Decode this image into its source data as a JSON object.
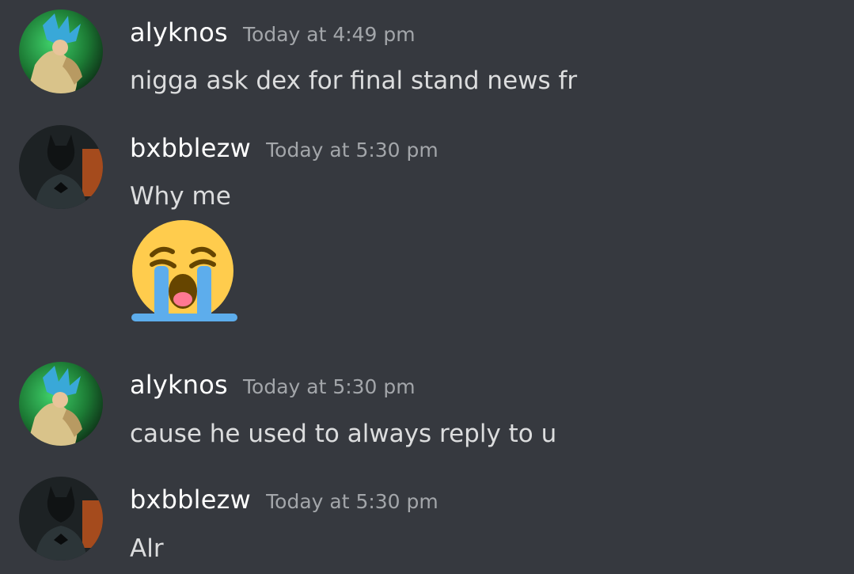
{
  "messages": [
    {
      "author": "alyknos",
      "timestamp": "Today at 4:49 pm",
      "text": "nigga ask dex for final stand news fr",
      "avatar_icon": "goku-avatar-icon"
    },
    {
      "author": "bxbblezw",
      "timestamp": "Today at 5:30 pm",
      "text": "Why me",
      "emoji": "loudly-crying-face-emoji",
      "avatar_icon": "batman-avatar-icon"
    },
    {
      "author": "alyknos",
      "timestamp": "Today at 5:30 pm",
      "text": "cause he used to always reply to u",
      "avatar_icon": "goku-avatar-icon"
    },
    {
      "author": "bxbblezw",
      "timestamp": "Today at 5:30 pm",
      "text": "Alr",
      "avatar_icon": "batman-avatar-icon"
    }
  ],
  "colors": {
    "background": "#36393f",
    "username": "#ffffff",
    "timestamp": "#a3a6aa",
    "text": "#dcddde"
  }
}
